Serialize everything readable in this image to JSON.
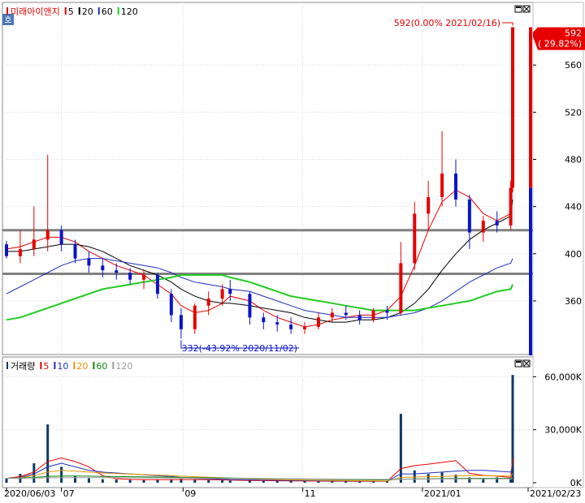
{
  "stock": {
    "name": "미래아이앤지",
    "badge": "호"
  },
  "price_legend": [
    {
      "label": "5",
      "color": "#e60000"
    },
    {
      "label": "20",
      "color": "#000000"
    },
    {
      "label": "60",
      "color": "#1f2fbf"
    },
    {
      "label": "120",
      "color": "#22cc22"
    }
  ],
  "volume_legend": {
    "title": "거래량",
    "items": [
      {
        "label": "5",
        "color": "#e60000"
      },
      {
        "label": "10",
        "color": "#1f2fbf"
      },
      {
        "label": "20",
        "color": "#e69500"
      },
      {
        "label": "60",
        "color": "#118811"
      },
      {
        "label": "120",
        "color": "#9a9a9a"
      }
    ]
  },
  "annotations": {
    "high": "592(0.00% 2021/02/16)",
    "low": "332(-43.92% 2020/11/02)"
  },
  "current_price": {
    "value": "592",
    "change": "( 29.82%)"
  },
  "price_axis": {
    "ticks": [
      "560",
      "520",
      "480",
      "440",
      "400",
      "360"
    ]
  },
  "volume_axis": {
    "ticks": [
      "60,000K",
      "30,000K",
      "0K"
    ]
  },
  "date_axis": {
    "labels": [
      "2020/06/03",
      "07",
      "09",
      "11",
      "2021/01",
      "2021/02/23"
    ]
  },
  "colors": {
    "up": "#e60000",
    "down": "#0a14c8",
    "hline": "#808080"
  },
  "chart_data": [
    {
      "type": "candlestick",
      "title": "미래아이앤지",
      "ylim": [
        318,
        600
      ],
      "x_range": [
        "2020-06-03",
        "2021-02-23"
      ],
      "horizontal_lines": [
        420,
        383
      ],
      "ohlc": [
        [
          "2020-06-03",
          408,
          411,
          396,
          398
        ],
        [
          "2020-06-10",
          398,
          420,
          392,
          404
        ],
        [
          "2020-06-17",
          404,
          440,
          398,
          412
        ],
        [
          "2020-06-24",
          412,
          484,
          402,
          420
        ],
        [
          "2020-07-01",
          420,
          424,
          402,
          408
        ],
        [
          "2020-07-08",
          408,
          412,
          392,
          396
        ],
        [
          "2020-07-15",
          396,
          402,
          384,
          390
        ],
        [
          "2020-07-22",
          390,
          396,
          380,
          386
        ],
        [
          "2020-07-29",
          386,
          392,
          378,
          384
        ],
        [
          "2020-08-05",
          384,
          388,
          374,
          378
        ],
        [
          "2020-08-12",
          378,
          386,
          370,
          382
        ],
        [
          "2020-08-19",
          382,
          384,
          362,
          366
        ],
        [
          "2020-08-26",
          366,
          370,
          342,
          348
        ],
        [
          "2020-08-31",
          348,
          354,
          328,
          336
        ],
        [
          "2020-09-07",
          336,
          358,
          332,
          356
        ],
        [
          "2020-09-14",
          356,
          368,
          348,
          362
        ],
        [
          "2020-09-21",
          362,
          374,
          356,
          370
        ],
        [
          "2020-09-25",
          370,
          378,
          360,
          366
        ],
        [
          "2020-10-05",
          366,
          368,
          340,
          346
        ],
        [
          "2020-10-12",
          346,
          350,
          336,
          342
        ],
        [
          "2020-10-19",
          342,
          348,
          334,
          340
        ],
        [
          "2020-10-26",
          340,
          346,
          332,
          336
        ],
        [
          "2020-11-02",
          336,
          342,
          332,
          338
        ],
        [
          "2020-11-09",
          338,
          350,
          336,
          346
        ],
        [
          "2020-11-16",
          346,
          354,
          342,
          350
        ],
        [
          "2020-11-23",
          350,
          356,
          344,
          348
        ],
        [
          "2020-11-30",
          348,
          352,
          340,
          344
        ],
        [
          "2020-12-07",
          344,
          354,
          342,
          352
        ],
        [
          "2020-12-14",
          352,
          356,
          344,
          350
        ],
        [
          "2020-12-21",
          350,
          410,
          348,
          392
        ],
        [
          "2020-12-28",
          392,
          444,
          386,
          434
        ],
        [
          "2021-01-04",
          434,
          462,
          420,
          448
        ],
        [
          "2021-01-11",
          448,
          504,
          440,
          468
        ],
        [
          "2021-01-18",
          468,
          480,
          440,
          446
        ],
        [
          "2021-01-25",
          446,
          450,
          404,
          418
        ],
        [
          "2021-02-01",
          418,
          432,
          410,
          428
        ],
        [
          "2021-02-08",
          428,
          436,
          418,
          424
        ],
        [
          "2021-02-15",
          424,
          462,
          420,
          456
        ],
        [
          "2021-02-16",
          456,
          592,
          452,
          592
        ]
      ],
      "series": [
        {
          "name": "5",
          "values": [
            404,
            406,
            410,
            414,
            414,
            410,
            402,
            396,
            390,
            386,
            382,
            374,
            366,
            356,
            350,
            352,
            358,
            364,
            360,
            352,
            346,
            342,
            338,
            340,
            344,
            346,
            348,
            348,
            352,
            364,
            390,
            420,
            444,
            454,
            448,
            434,
            428,
            434,
            470
          ]
        },
        {
          "name": "20",
          "values": [
            402,
            402,
            404,
            406,
            408,
            408,
            406,
            402,
            396,
            390,
            386,
            382,
            376,
            370,
            364,
            360,
            358,
            358,
            356,
            354,
            352,
            350,
            346,
            344,
            342,
            342,
            344,
            344,
            346,
            350,
            358,
            370,
            386,
            400,
            412,
            420,
            426,
            432,
            446
          ]
        },
        {
          "name": "60",
          "values": [
            366,
            372,
            378,
            384,
            390,
            394,
            396,
            396,
            394,
            392,
            390,
            388,
            384,
            380,
            376,
            374,
            372,
            370,
            368,
            364,
            360,
            356,
            352,
            350,
            348,
            346,
            346,
            346,
            346,
            348,
            350,
            354,
            360,
            368,
            376,
            382,
            388,
            392,
            396
          ]
        },
        {
          "name": "120",
          "values": [
            344,
            346,
            350,
            354,
            358,
            362,
            366,
            370,
            372,
            374,
            376,
            378,
            380,
            382,
            382,
            382,
            382,
            380,
            376,
            372,
            368,
            364,
            362,
            360,
            358,
            356,
            354,
            352,
            352,
            352,
            352,
            354,
            356,
            358,
            360,
            364,
            368,
            370,
            374
          ]
        }
      ]
    },
    {
      "type": "bar",
      "title": "거래량",
      "units": "K",
      "ylim": [
        0,
        62000
      ],
      "x": [
        "2020-06-03",
        "2020-06-10",
        "2020-06-17",
        "2020-06-24",
        "2020-07-01",
        "2020-07-08",
        "2020-07-15",
        "2020-07-22",
        "2020-07-29",
        "2020-08-05",
        "2020-08-12",
        "2020-08-19",
        "2020-08-26",
        "2020-08-31",
        "2020-09-07",
        "2020-09-14",
        "2020-09-21",
        "2020-09-25",
        "2020-10-05",
        "2020-10-12",
        "2020-10-19",
        "2020-10-26",
        "2020-11-02",
        "2020-11-09",
        "2020-11-16",
        "2020-11-23",
        "2020-11-30",
        "2020-12-07",
        "2020-12-14",
        "2020-12-21",
        "2020-12-28",
        "2021-01-04",
        "2021-01-11",
        "2021-01-18",
        "2021-01-25",
        "2021-02-01",
        "2021-02-08",
        "2021-02-15",
        "2021-02-16"
      ],
      "values": [
        2500,
        5000,
        11000,
        33000,
        9000,
        4000,
        2500,
        2000,
        1800,
        1600,
        1500,
        1800,
        2000,
        2200,
        1600,
        1500,
        1400,
        1200,
        1100,
        1000,
        1000,
        900,
        900,
        800,
        800,
        900,
        700,
        800,
        900,
        39000,
        7000,
        5000,
        6000,
        4500,
        3000,
        2500,
        3000,
        2000,
        61000
      ],
      "series": [
        {
          "name": "5",
          "values": [
            2500,
            3500,
            6000,
            12000,
            14000,
            12000,
            9000,
            4000,
            2300,
            1900,
            1700,
            1700,
            1700,
            1800,
            1800,
            1700,
            1600,
            1500,
            1300,
            1200,
            1100,
            1000,
            950,
            900,
            850,
            850,
            820,
            800,
            820,
            8000,
            9700,
            10500,
            11500,
            12500,
            5300,
            4200,
            3700,
            3000,
            14000
          ]
        },
        {
          "name": "10",
          "values": [
            2500,
            3000,
            5000,
            9000,
            11000,
            9000,
            7000,
            6000,
            5500,
            5000,
            4500,
            4000,
            3500,
            3000,
            2500,
            2200,
            2000,
            1800,
            1600,
            1500,
            1400,
            1300,
            1200,
            1100,
            1000,
            1000,
            950,
            900,
            900,
            5000,
            5000,
            5500,
            6000,
            6500,
            7000,
            7000,
            6500,
            6000,
            9000
          ]
        },
        {
          "name": "20",
          "values": [
            2500,
            2800,
            4000,
            6000,
            7000,
            6500,
            6000,
            5500,
            5200,
            4900,
            4600,
            4300,
            4000,
            3700,
            3400,
            3100,
            2800,
            2500,
            2200,
            2000,
            1800,
            1600,
            1500,
            1400,
            1300,
            1200,
            1100,
            1000,
            950,
            3000,
            3200,
            3400,
            3600,
            3800,
            4000,
            4000,
            3900,
            3800,
            5000
          ]
        },
        {
          "name": "60",
          "values": [
            2500,
            2600,
            3000,
            3600,
            3800,
            3800,
            3700,
            3600,
            3500,
            3400,
            3300,
            3200,
            3100,
            3000,
            2900,
            2800,
            2700,
            2600,
            2500,
            2400,
            2300,
            2200,
            2100,
            2000,
            1900,
            1800,
            1700,
            1600,
            1600,
            2000,
            2100,
            2200,
            2300,
            2400,
            2500,
            2500,
            2500,
            2500,
            3000
          ]
        },
        {
          "name": "120",
          "values": [
            2500,
            2500,
            2600,
            2800,
            2900,
            2900,
            2900,
            2900,
            2850,
            2800,
            2750,
            2700,
            2650,
            2600,
            2550,
            2500,
            2450,
            2400,
            2350,
            2300,
            2250,
            2200,
            2150,
            2100,
            2050,
            2000,
            1950,
            1900,
            1900,
            2000,
            2000,
            2050,
            2100,
            2150,
            2200,
            2200,
            2200,
            2200,
            2400
          ]
        }
      ]
    }
  ]
}
